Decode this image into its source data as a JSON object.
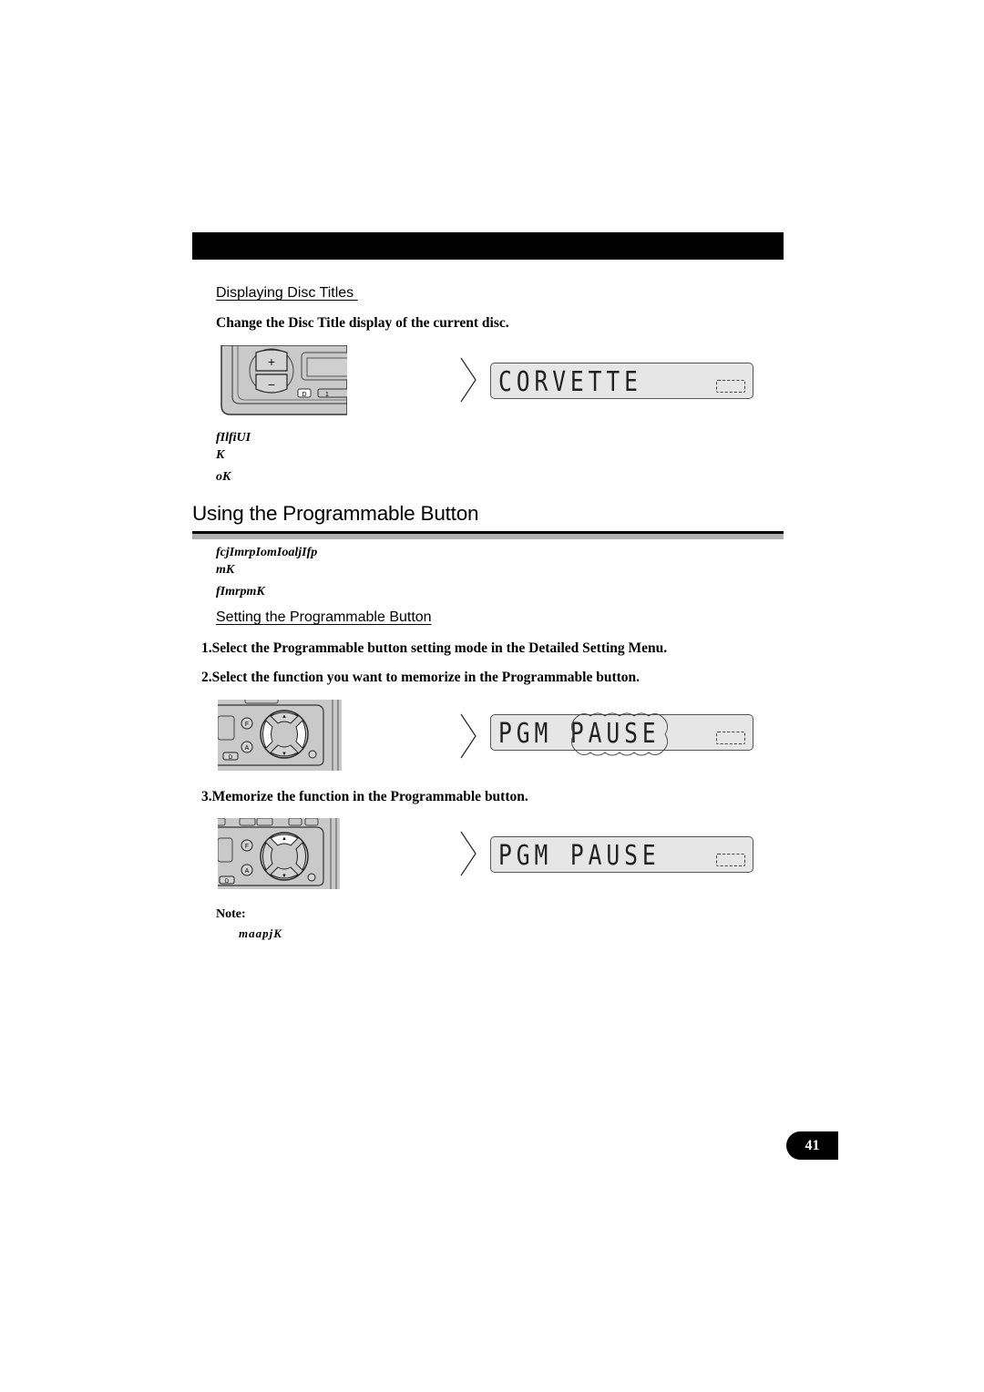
{
  "section1": {
    "subheading": "Displaying Disc Titles ",
    "instruction": "Change the Disc Title display of the current disc.",
    "lcd_text": "CORVETTE",
    "garbled_lines": [
      "fIlfiUI",
      "K",
      "oK"
    ]
  },
  "section2": {
    "title": "Using the Programmable Button",
    "garbled_lines": [
      "fcjImrpIomIoaljIfp",
      "mK",
      "fImrpmK"
    ],
    "subheading": "Setting the Programmable Button",
    "steps": [
      "1.Select the Programmable button setting mode in the Detailed Setting Menu.",
      "2.Select the function you want to memorize in the Programmable button.",
      "3.Memorize the function in the Programmable button."
    ],
    "lcd_step2_text": "PGM PAUSE",
    "lcd_step3_text": "PGM PAUSE",
    "note_label": "Note:",
    "note_text": "maapjK"
  },
  "device_labels": {
    "plus": "+",
    "minus": "−",
    "button_d": "D",
    "button_1": "1",
    "button_f": "F",
    "button_a": "A",
    "up": "▲",
    "down": "▼"
  },
  "page_number": "41"
}
